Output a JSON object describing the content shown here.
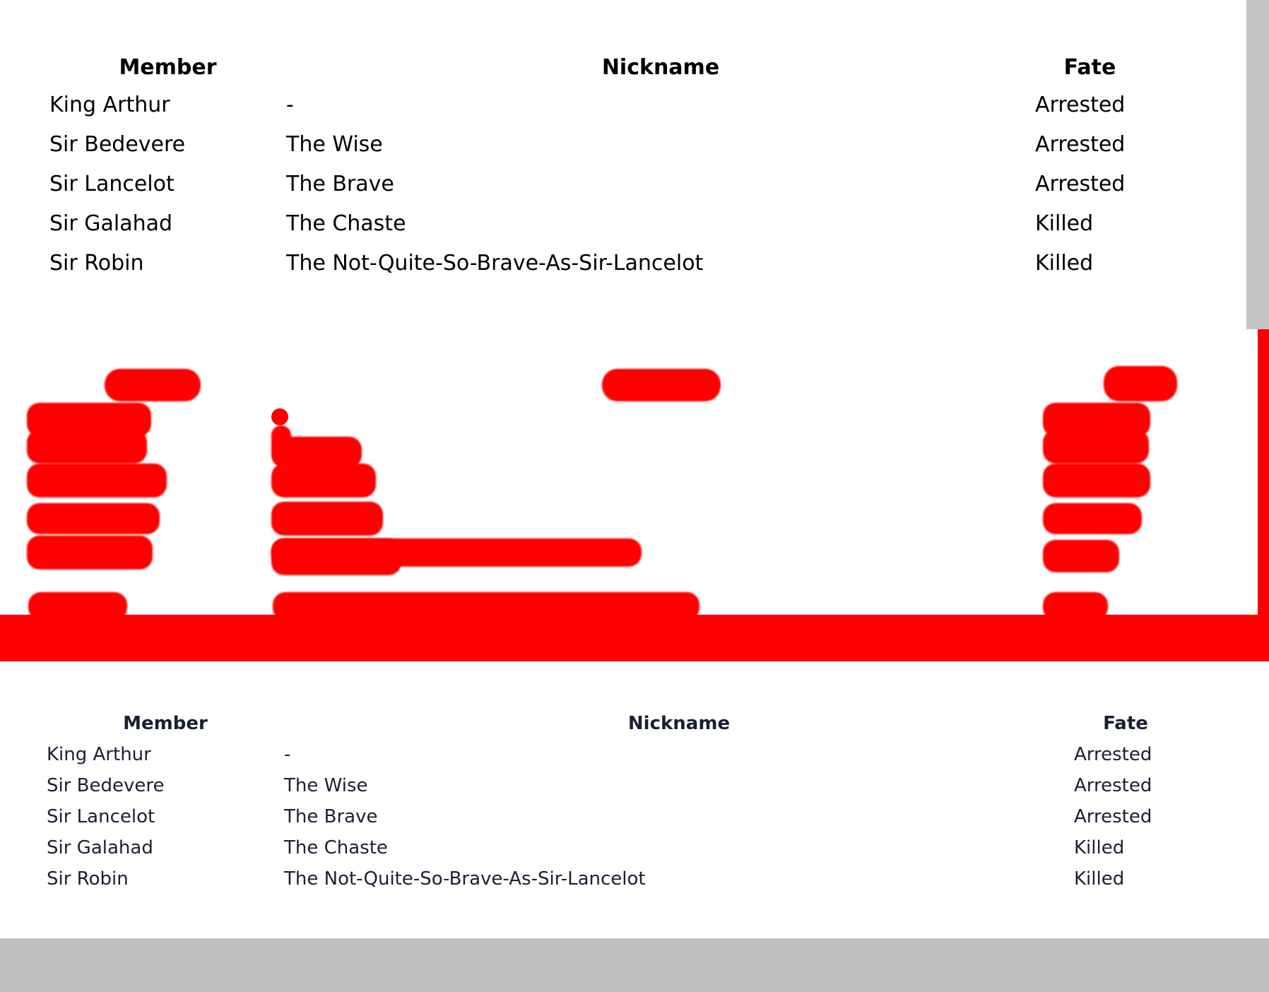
{
  "table": {
    "headers": {
      "member": "Member",
      "nickname": "Nickname",
      "fate": "Fate"
    },
    "rows": [
      {
        "member": "King Arthur",
        "nickname": "-",
        "fate": "Arrested"
      },
      {
        "member": "Sir Bedevere",
        "nickname": "The Wise",
        "fate": "Arrested"
      },
      {
        "member": "Sir Lancelot",
        "nickname": "The Brave",
        "fate": "Arrested"
      },
      {
        "member": "Sir Galahad",
        "nickname": "The Chaste",
        "fate": "Killed"
      },
      {
        "member": "Sir Robin",
        "nickname": "The Not-Quite-So-Brave-As-Sir-Lancelot",
        "fate": "Killed"
      }
    ]
  },
  "colors": {
    "diff_red": "#ff0000",
    "text_dark": "#000000",
    "text_navy": "#1a2033",
    "gray_bar": "#c0c0c0",
    "scroll_gray": "#c4c4c4"
  }
}
